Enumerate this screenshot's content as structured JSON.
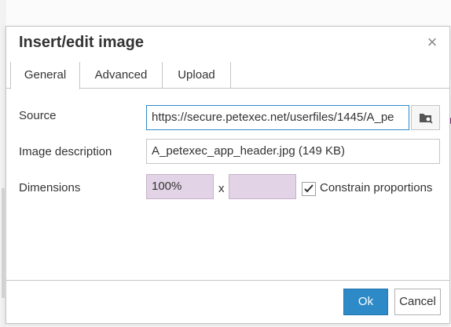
{
  "dialog": {
    "title": "Insert/edit image",
    "close_symbol": "×",
    "close_icon": "close-icon"
  },
  "tabs": [
    {
      "label": "General",
      "active": true
    },
    {
      "label": "Advanced",
      "active": false
    },
    {
      "label": "Upload",
      "active": false
    }
  ],
  "form": {
    "source_label": "Source",
    "source_value": "https://secure.petexec.net/userfiles/1445/A_pe",
    "browse_icon": "folder-search-icon",
    "description_label": "Image description",
    "description_value": "A_petexec_app_header.jpg (149 KB)",
    "dimensions_label": "Dimensions",
    "width_value": "100%",
    "height_value": "",
    "separator": "x",
    "constrain_label": "Constrain proportions",
    "constrain_checked": true
  },
  "footer": {
    "ok_label": "Ok",
    "cancel_label": "Cancel"
  },
  "colors": {
    "accent": "#2d8ac7",
    "dimension_field_bg": "#e3d3e6",
    "border": "#c5c5c5"
  }
}
